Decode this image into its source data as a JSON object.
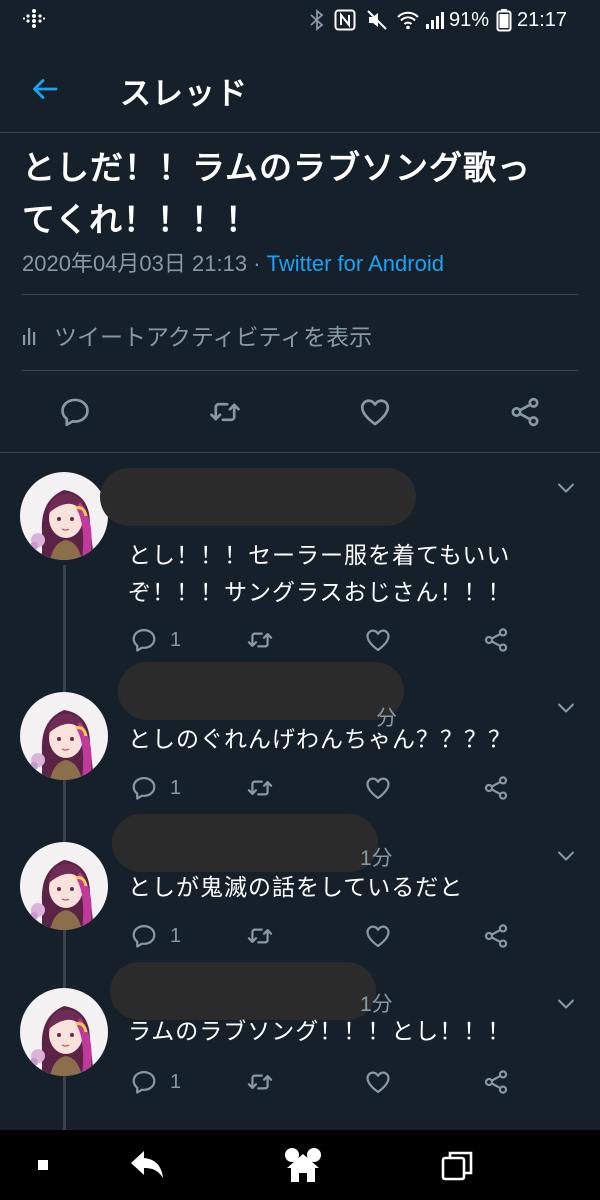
{
  "status_bar": {
    "battery_text": "91%",
    "time": "21:17",
    "icons": [
      "fitbit-dots-icon",
      "bluetooth-icon",
      "nfc-icon",
      "mute-icon",
      "wifi-icon",
      "signal-icon",
      "battery-icon"
    ]
  },
  "header": {
    "title": "スレッド",
    "back_icon": "arrow-left-icon"
  },
  "tweet": {
    "text_line1": "としだ！！ラムのラブソング歌っ",
    "text_line2": "てくれ！！！！",
    "date": "2020年04月03日 21:13",
    "separator": "·",
    "source": "Twitter for Android",
    "activity_label": "ツイートアクティビティを表示",
    "actions": [
      "reply-icon",
      "retweet-icon",
      "like-icon",
      "share-icon"
    ]
  },
  "replies": [
    {
      "handle_fragment": "",
      "text_line1": "とし！！！セーラー服を着てもいい",
      "text_line2": "ぞ！！！サングラスおじさん！！！",
      "reply_count": "1"
    },
    {
      "handle_fragment": "分",
      "text_line1": "としのぐれんげわんちゃん？？？？",
      "text_line2": "",
      "reply_count": "1"
    },
    {
      "handle_fragment": "1分",
      "text_line1": "としが鬼滅の話をしているだと",
      "text_line2": "",
      "reply_count": "1"
    },
    {
      "handle_fragment": "1分",
      "text_line1": "ラムのラブソング！！！とし！！！",
      "text_line2": "",
      "reply_count": "1"
    }
  ],
  "nav_bar": {
    "buttons": [
      "home-dot-icon",
      "back-icon",
      "mickey-home-icon",
      "recents-icon"
    ]
  },
  "colors": {
    "background": "#15202b",
    "accent": "#1da1f2",
    "secondary_text": "#8899a6",
    "divider": "#38444d",
    "redaction": "#2b2b2b",
    "nav_bar": "#000000"
  }
}
